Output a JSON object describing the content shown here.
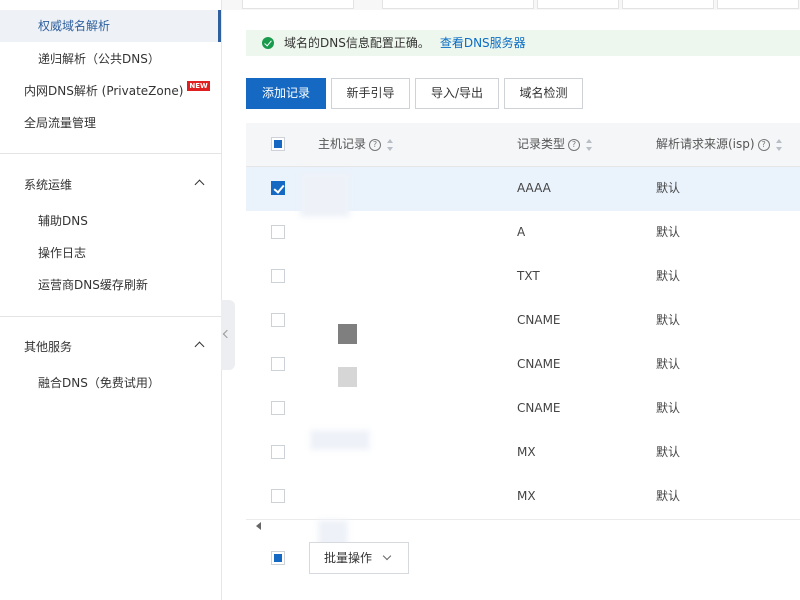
{
  "sidebar": {
    "items": [
      {
        "label": "权威域名解析",
        "active": true
      },
      {
        "label": "递归解析（公共DNS）"
      },
      {
        "label": "内网DNS解析 (PrivateZone)",
        "badge": "NEW"
      },
      {
        "label": "全局流量管理"
      }
    ],
    "groups": [
      {
        "title": "系统运维",
        "items": [
          "辅助DNS",
          "操作日志",
          "运营商DNS缓存刷新"
        ]
      },
      {
        "title": "其他服务",
        "items": [
          "融合DNS（免费试用）"
        ]
      }
    ]
  },
  "alert": {
    "message": "域名的DNS信息配置正确。",
    "link": "查看DNS服务器"
  },
  "toolbar": {
    "add_record": "添加记录",
    "guide": "新手引导",
    "import_export": "导入/导出",
    "domain_check": "域名检测"
  },
  "table": {
    "columns": {
      "host": "主机记录",
      "type": "记录类型",
      "isp": "解析请求来源(isp)"
    },
    "help_glyph": "?",
    "rows": [
      {
        "type": "AAAA",
        "isp": "默认",
        "checked": true
      },
      {
        "type": "A",
        "isp": "默认"
      },
      {
        "type": "TXT",
        "isp": "默认"
      },
      {
        "type": "CNAME",
        "isp": "默认"
      },
      {
        "type": "CNAME",
        "isp": "默认"
      },
      {
        "type": "CNAME",
        "isp": "默认"
      },
      {
        "type": "MX",
        "isp": "默认"
      },
      {
        "type": "MX",
        "isp": "默认"
      }
    ]
  },
  "footer": {
    "batch": "批量操作"
  },
  "colors": {
    "primary": "#1669c2",
    "success": "#1a9b4b",
    "link": "#0a6dc3",
    "badge": "#e02020"
  }
}
